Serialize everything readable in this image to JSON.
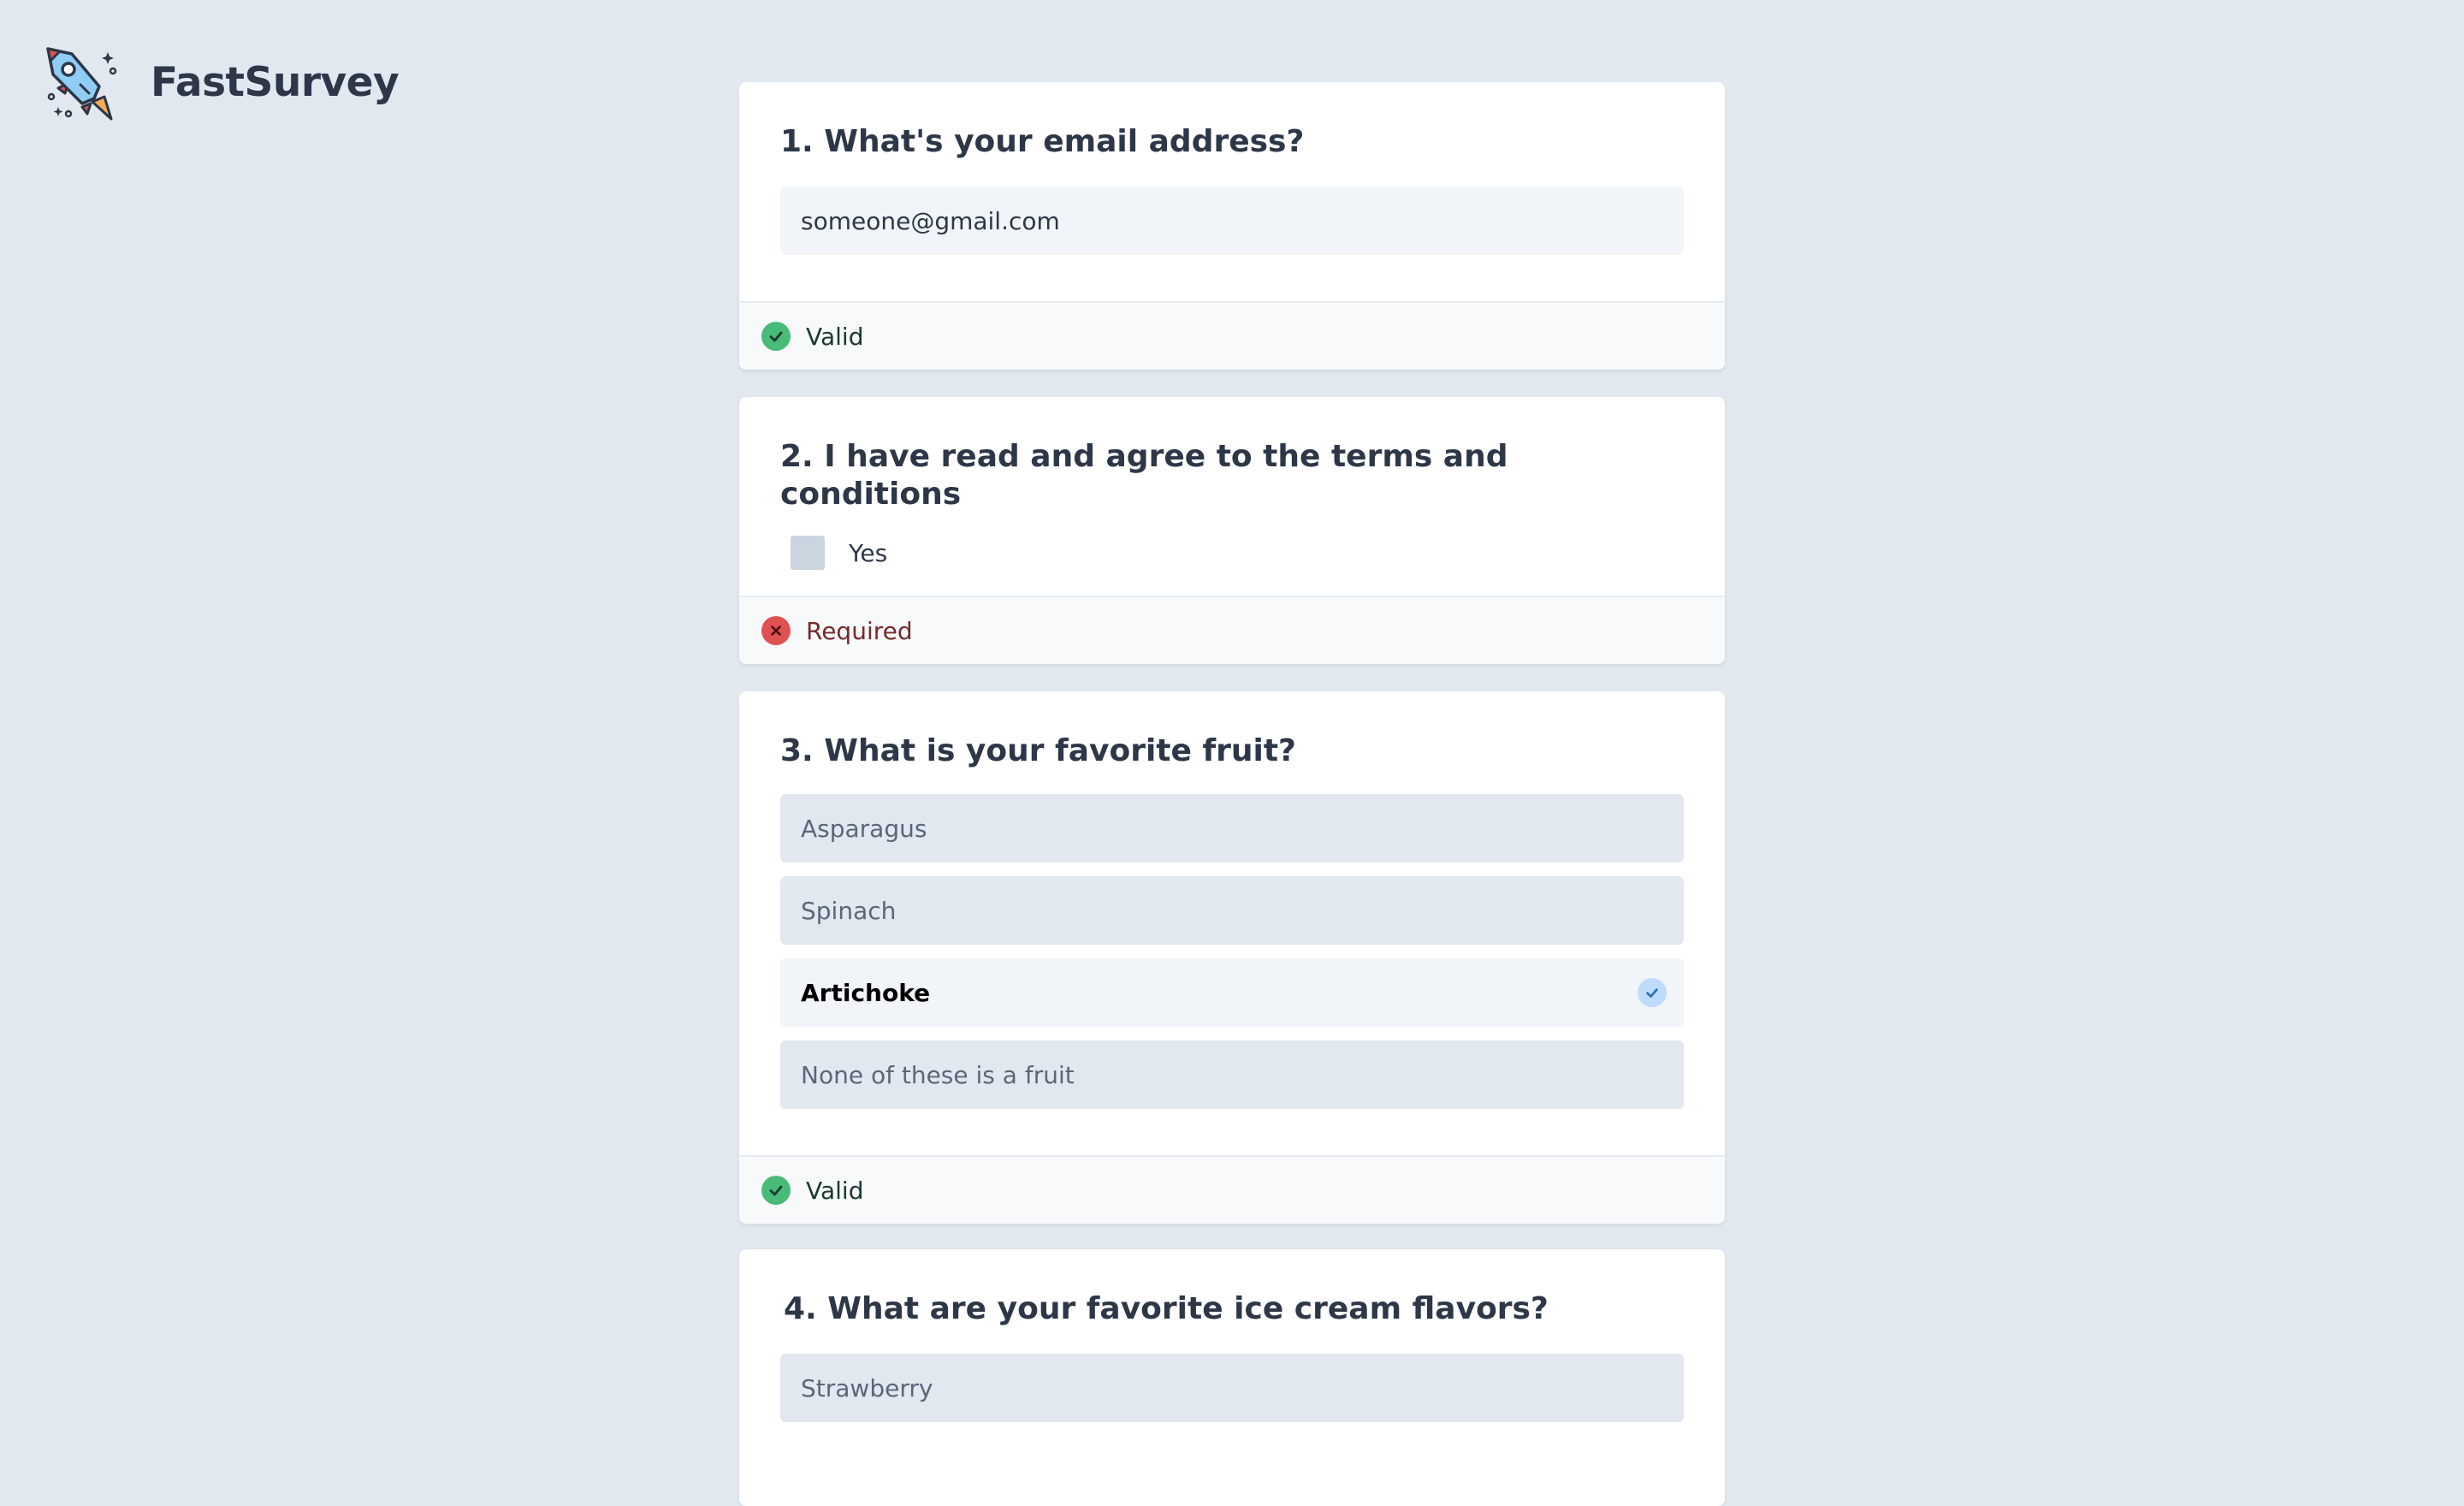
{
  "app": {
    "name": "FastSurvey",
    "logo_icon": "rocket-icon"
  },
  "colors": {
    "background": "#e2e8f0",
    "valid": "#48bb78",
    "invalid": "#e05252",
    "selected_check": "#bfdbfe"
  },
  "questions": [
    {
      "title": "1. What's your email address?",
      "type": "text",
      "value": "someone@gmail.com",
      "status": "Valid",
      "status_icon": "check-circle-icon"
    },
    {
      "title": "2. I have read and agree to the terms and conditions",
      "type": "checkbox",
      "option_label": "Yes",
      "checked": false,
      "status": "Required",
      "status_icon": "x-circle-icon"
    },
    {
      "title": "3. What is your favorite fruit?",
      "type": "radio",
      "options": [
        "Asparagus",
        "Spinach",
        "Artichoke",
        "None of these is a fruit"
      ],
      "selected": "Artichoke",
      "selected_icon": "check-icon",
      "status": "Valid",
      "status_icon": "check-circle-icon"
    },
    {
      "title": "4. What are your favorite ice cream flavors?",
      "type": "multi-select",
      "options": [
        "Strawberry"
      ]
    }
  ]
}
